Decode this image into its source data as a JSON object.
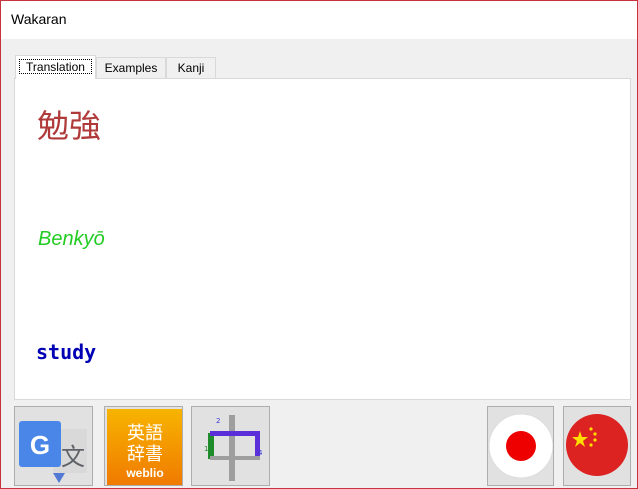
{
  "window": {
    "title": "Wakaran"
  },
  "tabs": [
    {
      "label": "Translation",
      "active": true
    },
    {
      "label": "Examples",
      "active": false
    },
    {
      "label": "Kanji",
      "active": false
    }
  ],
  "translation": {
    "kanji": "勉強",
    "romaji": "Benkyō",
    "meaning": "study"
  },
  "buttons": {
    "google_translate": {
      "icon": "google-translate-icon",
      "glyph": "文"
    },
    "weblio": {
      "icon": "weblio-dictionary-icon",
      "glyphs": "英語辞書",
      "brand": "weblio"
    },
    "stroke_order": {
      "icon": "stroke-order-icon",
      "glyph": "中"
    },
    "japan_flag": {
      "icon": "japan-flag-icon"
    },
    "china_flag": {
      "icon": "china-flag-icon"
    }
  },
  "colors": {
    "kanji": "#b03a3a",
    "romaji": "#22cc22",
    "meaning": "#0000b4",
    "window_border": "#c8323c"
  }
}
